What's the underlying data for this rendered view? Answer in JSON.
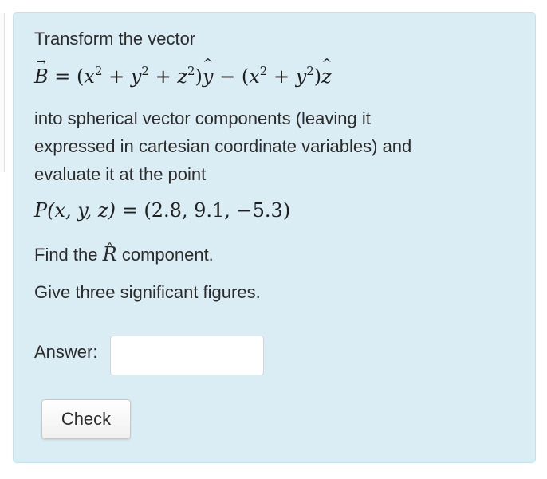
{
  "question": {
    "intro": "Transform the vector",
    "vector_name": "B",
    "vector_rhs": "(x² + y² + z²)ŷ − (x² + y²)ẑ",
    "instruction_lines": [
      "into spherical vector components (leaving it",
      "expressed in cartesian coordinate variables) and",
      "evaluate it at the point"
    ],
    "point_lhs": "P(x, y, z)",
    "point_rhs": "(2.8, 9.1, −5.3)",
    "find_prefix": "Find the",
    "find_symbol": "R",
    "find_suffix": "component.",
    "sig_figs": "Give three significant figures."
  },
  "answer": {
    "label": "Answer:",
    "value": "",
    "placeholder": ""
  },
  "check_button": {
    "label": "Check"
  },
  "colors": {
    "panel_background": "#daecf4",
    "panel_border": "#c7e1ec",
    "text": "#2b2b2b"
  }
}
